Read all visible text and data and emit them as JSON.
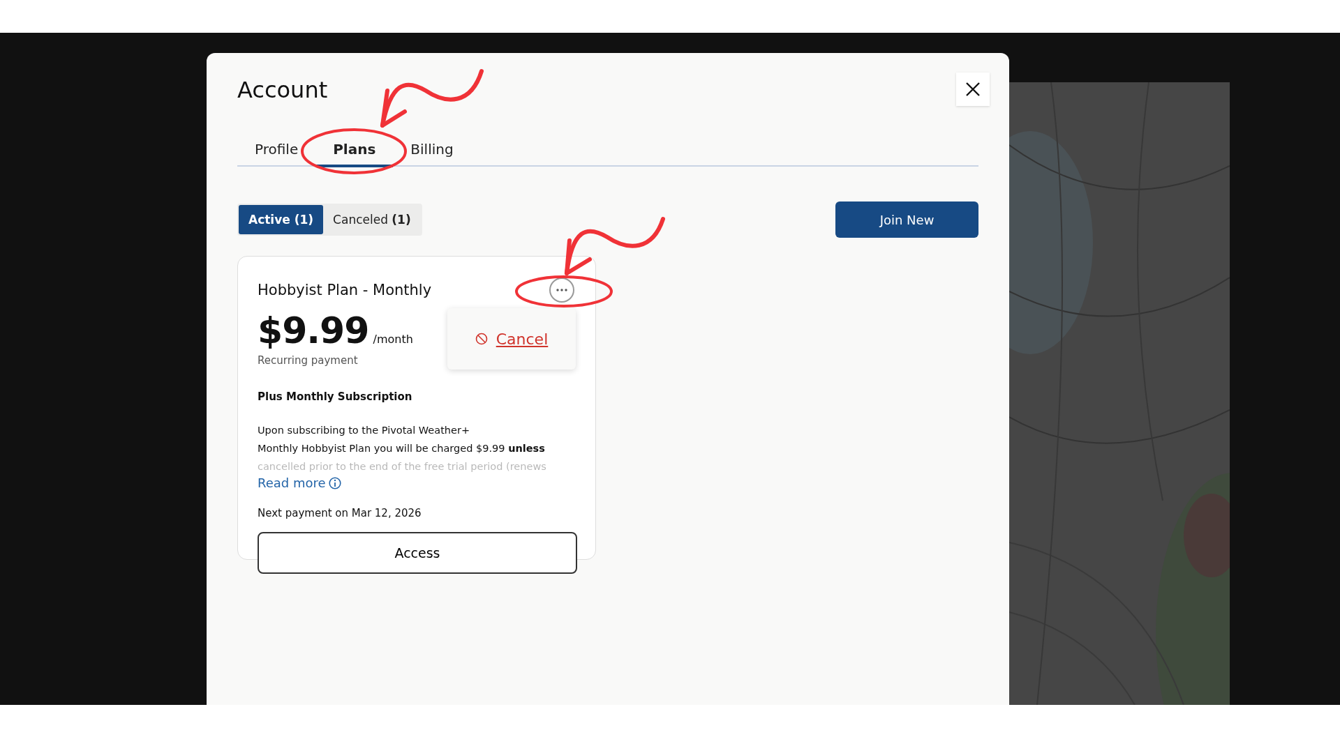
{
  "dialog": {
    "title": "Account",
    "tabs": [
      {
        "label": "Profile",
        "selected": false
      },
      {
        "label": "Plans",
        "selected": true
      },
      {
        "label": "Billing",
        "selected": false
      }
    ],
    "filters": [
      {
        "label": "Active (1)",
        "selected": true
      },
      {
        "label": "Canceled **(1)**",
        "selected": false
      }
    ],
    "join_button": "Join New",
    "plans": [
      {
        "name": "Hobbyist Plan - Monthly",
        "price": "$9.99",
        "period": "/month",
        "payment_type": "Recurring payment",
        "menu": {
          "open": true,
          "items": [
            {
              "label": "Cancel",
              "kind": "danger"
            }
          ]
        },
        "subtitle": "Plus Monthly Subscription",
        "description_lines": [
          "Upon subscribing to the Pivotal Weather+",
          "Monthly Hobbyist Plan you will be charged $9.99 **unless**",
          "cancelled prior to the end of the free trial period (renews"
        ],
        "read_more": "Read more",
        "next_payment": "Next payment on Mar 12, 2026",
        "action": "Access"
      }
    ]
  }
}
